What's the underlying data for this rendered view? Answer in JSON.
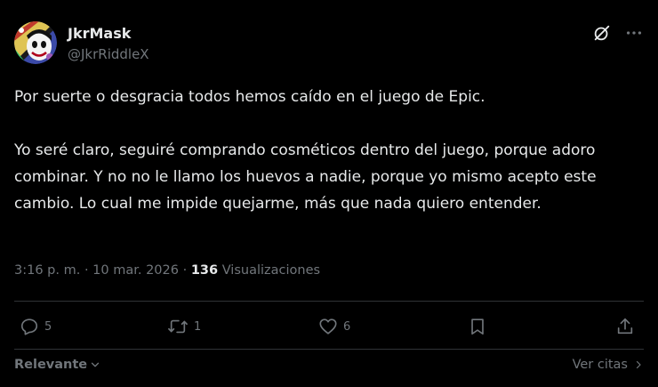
{
  "author": {
    "display_name": "JkrMask",
    "handle": "@JkrRiddleX",
    "avatar_icon": "joker-mask-avatar"
  },
  "top_actions": {
    "grok_icon": "grok-icon",
    "more_icon": "more-dots-icon"
  },
  "post": {
    "paragraph_1": "Por suerte o desgracia todos hemos caído en el juego de Epic.",
    "paragraph_2": "Yo seré claro, seguiré comprando cosméticos dentro del juego, porque adoro combinar. Y no no le llamo los huevos a nadie, porque yo mismo acepto este cambio. Lo cual me impide quejarme, más que nada quiero entender."
  },
  "meta": {
    "time": "3:16 p. m.",
    "separator_1": "·",
    "date": "10 mar. 2026",
    "separator_2": "·",
    "views_count": "136",
    "views_label": "Visualizaciones"
  },
  "actions": {
    "replies": "5",
    "reposts": "1",
    "likes": "6"
  },
  "footer": {
    "sort_label": "Relevante",
    "quotes_label": "Ver citas"
  },
  "colors": {
    "background": "#000000",
    "text_primary": "#e7e9ea",
    "text_secondary": "#71767b",
    "divider": "#2f3336"
  }
}
